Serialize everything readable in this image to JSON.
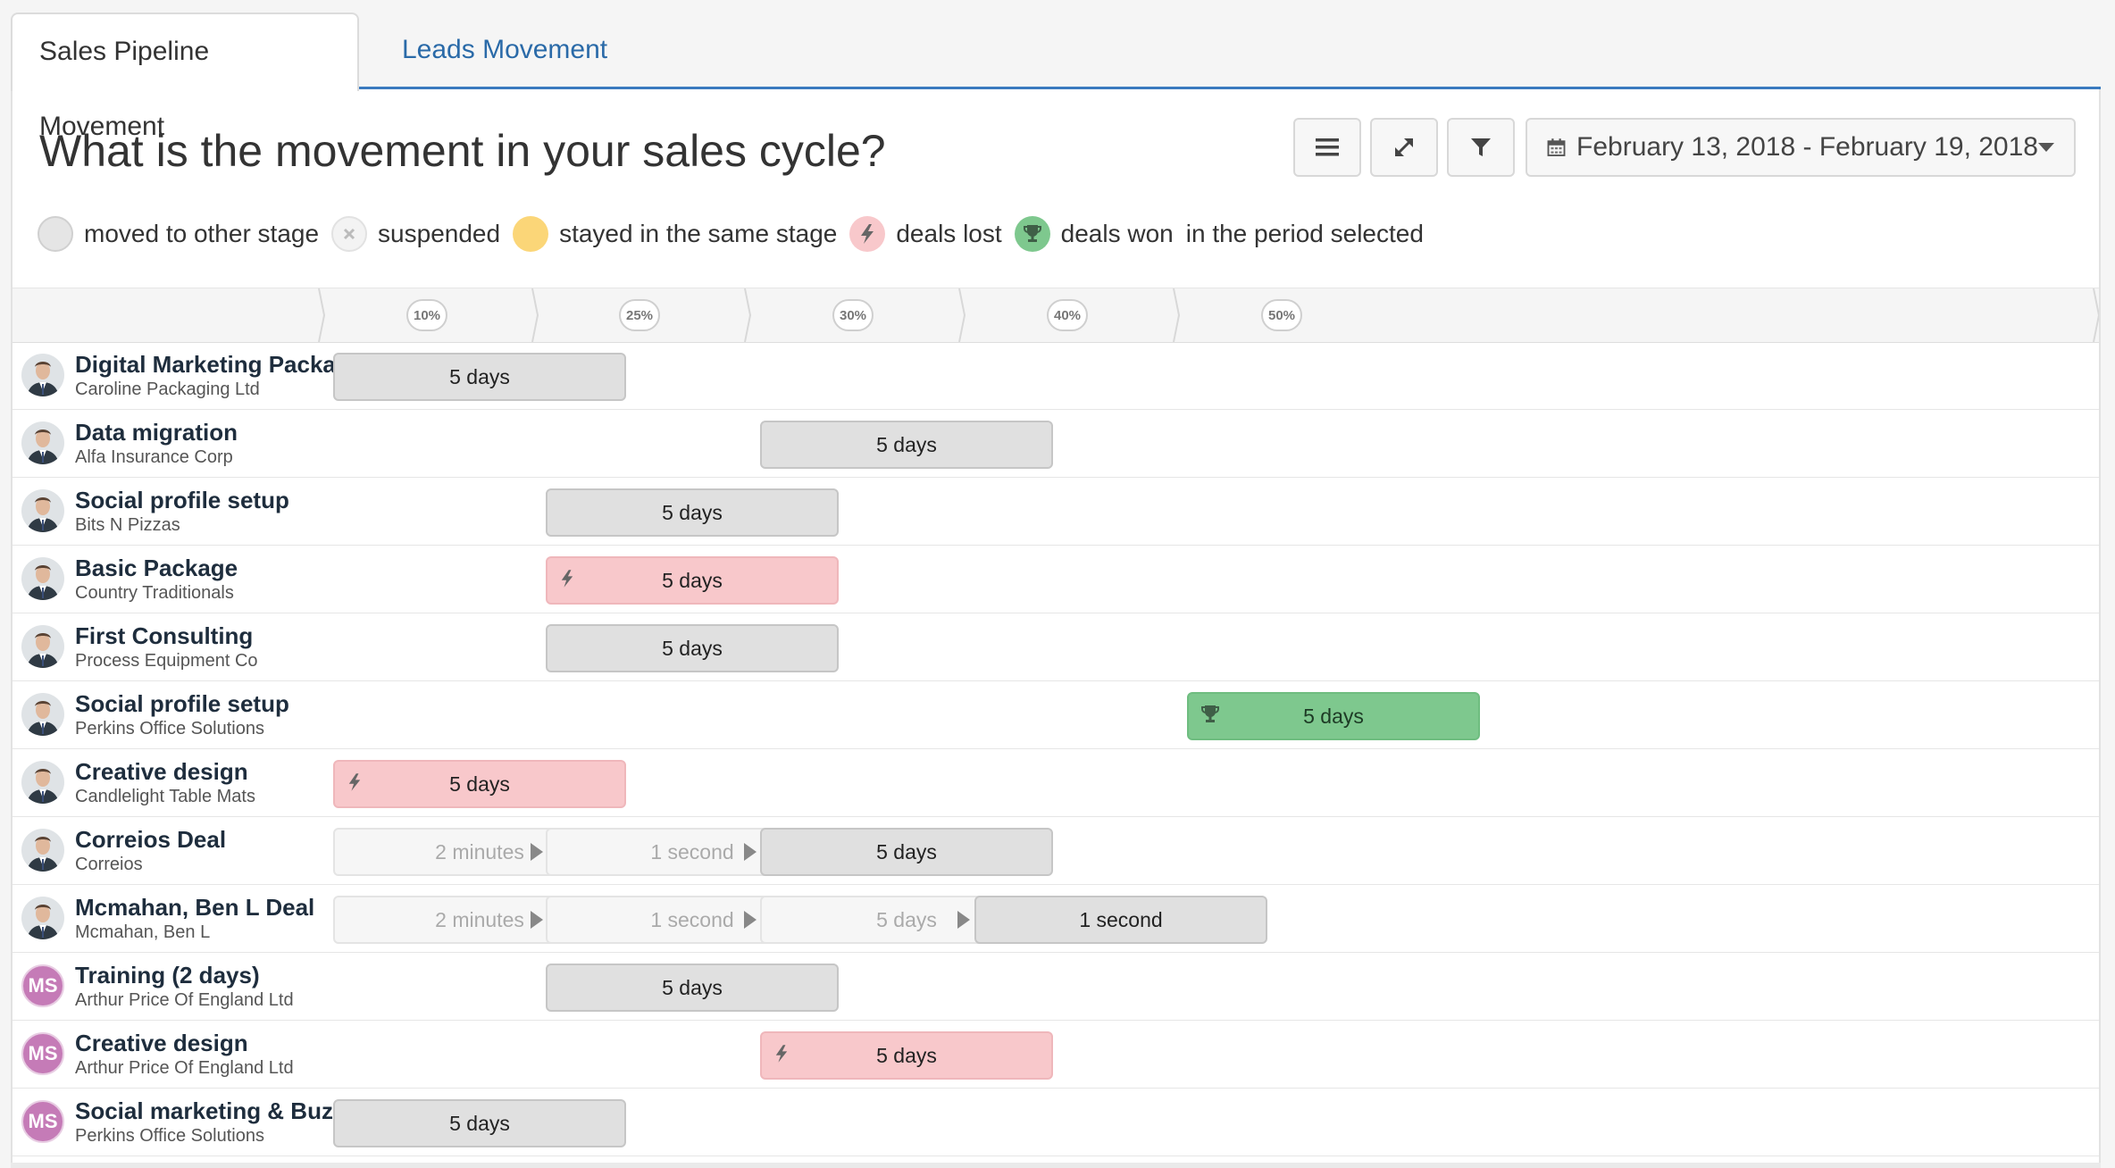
{
  "tabs": [
    {
      "label": "Sales Pipeline Movement",
      "active": true
    },
    {
      "label": "Leads Movement",
      "active": false
    }
  ],
  "header": {
    "title": "What is the movement in your sales cycle?",
    "date_range": "February 13, 2018 - February 19, 2018"
  },
  "legend": {
    "moved": "moved to other stage",
    "suspended": "suspended",
    "stayed": "stayed in the same stage",
    "lost": "deals lost",
    "won": "deals won",
    "suffix": "in the period selected"
  },
  "stages": [
    "10%",
    "25%",
    "30%",
    "40%",
    "50%"
  ],
  "colors": {
    "accent": "#3a7abf",
    "moved": "#e0e0e0",
    "stayed": "#fbd678",
    "lost": "#f8c8cb",
    "won": "#7ec88e",
    "avatar_ms": "#c57bb7"
  },
  "rows": [
    {
      "title": "Digital Marketing Package",
      "company": "Caroline Packaging Ltd",
      "avatar": "photo",
      "cells": [
        {
          "stage": 0,
          "label": "5 days",
          "status": "moved"
        }
      ]
    },
    {
      "title": "Data migration",
      "company": "Alfa Insurance Corp",
      "avatar": "photo",
      "cells": [
        {
          "stage": 2,
          "label": "5 days",
          "status": "moved"
        }
      ]
    },
    {
      "title": "Social profile setup",
      "company": "Bits N Pizzas",
      "avatar": "photo",
      "cells": [
        {
          "stage": 1,
          "label": "5 days",
          "status": "moved"
        }
      ]
    },
    {
      "title": "Basic Package",
      "company": "Country Traditionals",
      "avatar": "photo",
      "cells": [
        {
          "stage": 1,
          "label": "5 days",
          "status": "lost"
        }
      ]
    },
    {
      "title": "First Consulting",
      "company": "Process Equipment Co",
      "avatar": "photo",
      "cells": [
        {
          "stage": 1,
          "label": "5 days",
          "status": "moved"
        }
      ]
    },
    {
      "title": "Social profile setup",
      "company": "Perkins Office Solutions",
      "avatar": "photo",
      "cells": [
        {
          "stage": 4,
          "label": "5 days",
          "status": "won"
        }
      ]
    },
    {
      "title": "Creative design",
      "company": "Candlelight Table Mats",
      "avatar": "photo",
      "cells": [
        {
          "stage": 0,
          "label": "5 days",
          "status": "lost"
        }
      ]
    },
    {
      "title": "Correios Deal",
      "company": "Correios",
      "avatar": "photo",
      "cells": [
        {
          "stage": 0,
          "label": "2 minutes",
          "status": "faded"
        },
        {
          "stage": 1,
          "label": "1 second",
          "status": "faded"
        },
        {
          "stage": 2,
          "label": "5 days",
          "status": "moved"
        }
      ]
    },
    {
      "title": "Mcmahan, Ben L Deal",
      "company": "Mcmahan, Ben L",
      "avatar": "photo",
      "cells": [
        {
          "stage": 0,
          "label": "2 minutes",
          "status": "faded"
        },
        {
          "stage": 1,
          "label": "1 second",
          "status": "faded"
        },
        {
          "stage": 2,
          "label": "5 days",
          "status": "faded"
        },
        {
          "stage": 3,
          "label": "1 second",
          "status": "moved"
        }
      ]
    },
    {
      "title": "Training (2 days)",
      "company": "Arthur Price Of England Ltd",
      "avatar": "MS",
      "cells": [
        {
          "stage": 1,
          "label": "5 days",
          "status": "moved"
        }
      ]
    },
    {
      "title": "Creative design",
      "company": "Arthur Price Of England Ltd",
      "avatar": "MS",
      "cells": [
        {
          "stage": 2,
          "label": "5 days",
          "status": "lost"
        }
      ]
    },
    {
      "title": "Social marketing & Buzz",
      "company": "Perkins Office Solutions",
      "avatar": "MS",
      "cells": [
        {
          "stage": 0,
          "label": "5 days",
          "status": "moved"
        }
      ]
    }
  ]
}
